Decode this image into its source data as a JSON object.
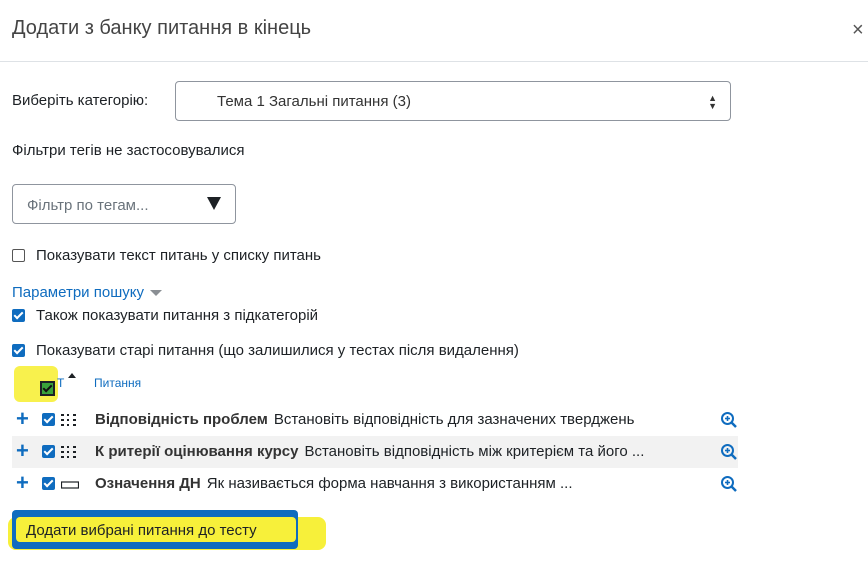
{
  "dialog": {
    "title": "Додати з банку питання в кінець",
    "close_glyph": "×"
  },
  "category": {
    "label": "Виберіть категорію:",
    "selected": "Тема 1 Загальні питання (3)"
  },
  "tags": {
    "note": "Фільтри тегів не застосовувалися",
    "placeholder": "Фільтр по тегам..."
  },
  "options": {
    "show_text": {
      "label": "Показувати текст питань у списку питань",
      "checked": false
    },
    "search_params": "Параметри пошуку",
    "subcategories": {
      "label": "Також показувати питання з підкатегорій",
      "checked": true
    },
    "old_questions": {
      "label": "Показувати старі питання (що залишилися у тестах після видалення)",
      "checked": true
    }
  },
  "table": {
    "col_type": "Т",
    "col_question": "Питання",
    "rows": [
      {
        "name": "Відповідність проблем",
        "text": "Встановіть відповідність для зазначених тверджень",
        "type_icon": "matching-icon"
      },
      {
        "name": "К ритерії оцінювання курсу",
        "text": "Встановіть відповідність між критерієм та його ...",
        "type_icon": "matching-icon"
      },
      {
        "name": "Означення ДН",
        "text": "Як називається форма навчання з використанням ...",
        "type_icon": "short-answer-icon"
      }
    ]
  },
  "actions": {
    "add_selected": "Додати вибрані питання до тесту"
  },
  "colors": {
    "primary": "#0f6cbf",
    "highlight": "#f7f03a"
  }
}
